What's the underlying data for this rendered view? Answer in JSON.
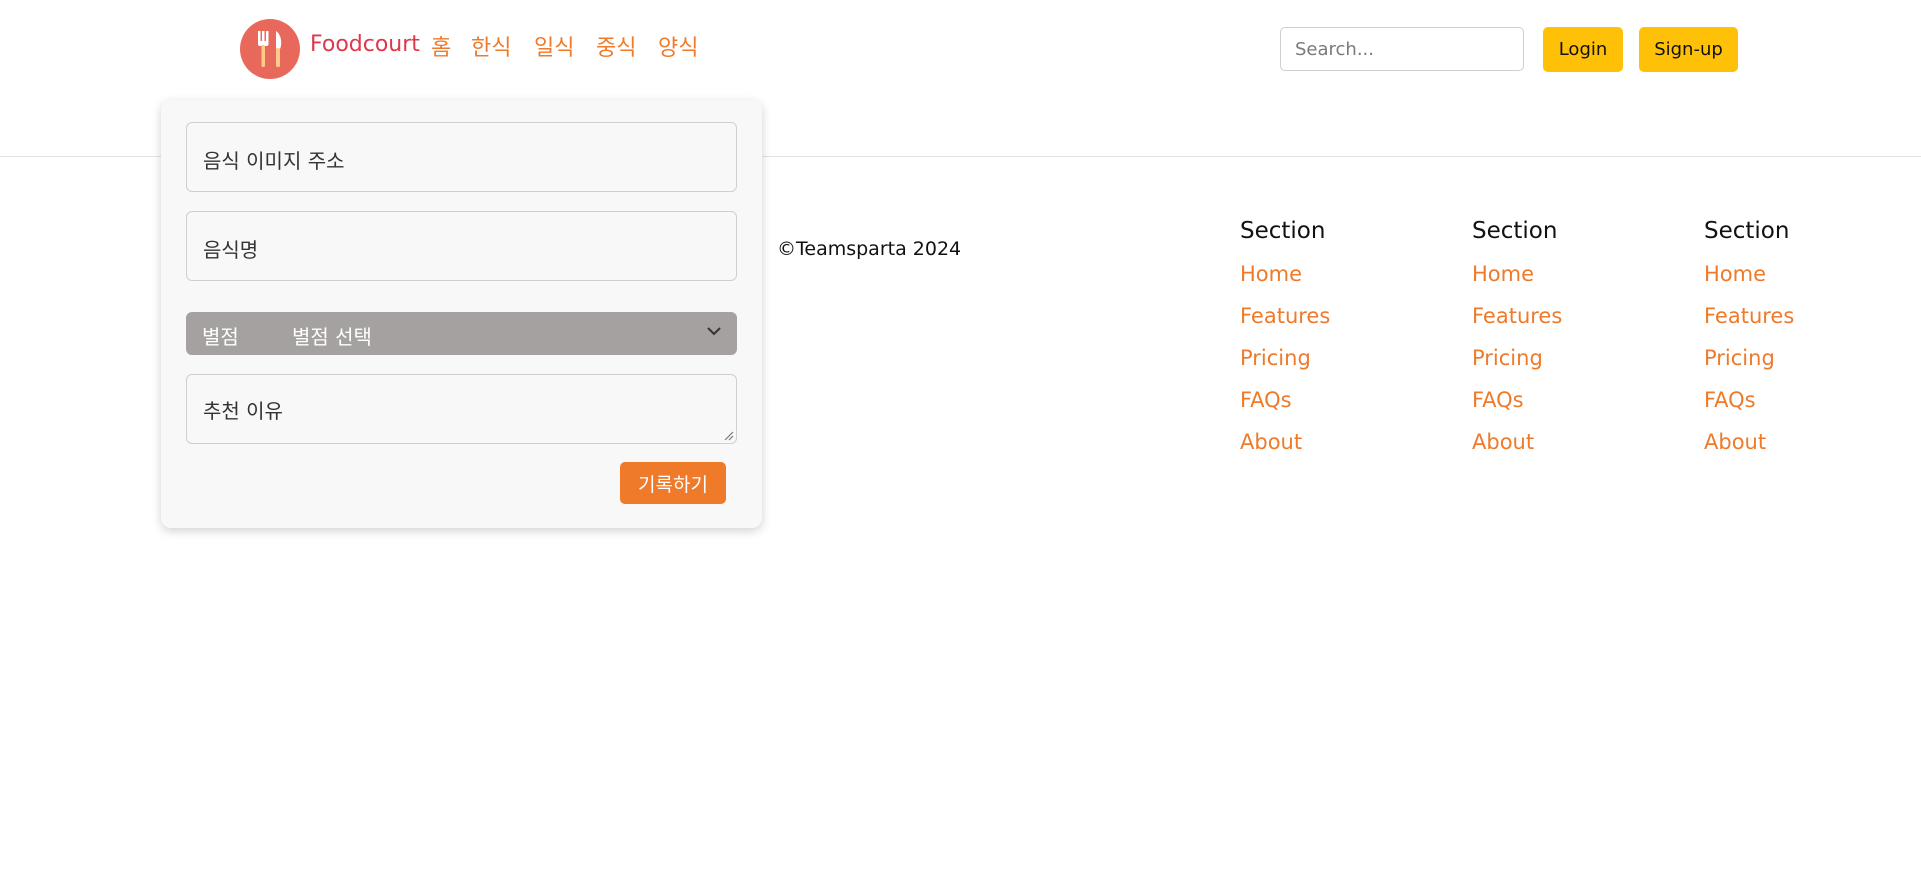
{
  "colors": {
    "brand": "#e0384a",
    "accent": "#ee7a2a",
    "yellow_button": "#ffc107",
    "logo_bg": "#e8695b",
    "select_bg": "#a5a1a1"
  },
  "header": {
    "logo_icon": "fork-knife-icon",
    "brand": "Foodcourt",
    "nav": [
      "홈",
      "한식",
      "일식",
      "중식",
      "양식"
    ],
    "search_placeholder": "Search...",
    "login_label": "Login",
    "signup_label": "Sign-up"
  },
  "form": {
    "image_url_placeholder": "음식 이미지 주소",
    "name_placeholder": "음식명",
    "rating_label": "별점",
    "rating_value": "별점 선택",
    "reason_placeholder": "추천 이유",
    "submit_label": "기록하기"
  },
  "footer": {
    "copyright": "©Teamsparta 2024",
    "sections": [
      {
        "heading": "Section",
        "links": [
          "Home",
          "Features",
          "Pricing",
          "FAQs",
          "About"
        ]
      },
      {
        "heading": "Section",
        "links": [
          "Home",
          "Features",
          "Pricing",
          "FAQs",
          "About"
        ]
      },
      {
        "heading": "Section",
        "links": [
          "Home",
          "Features",
          "Pricing",
          "FAQs",
          "About"
        ]
      }
    ]
  }
}
